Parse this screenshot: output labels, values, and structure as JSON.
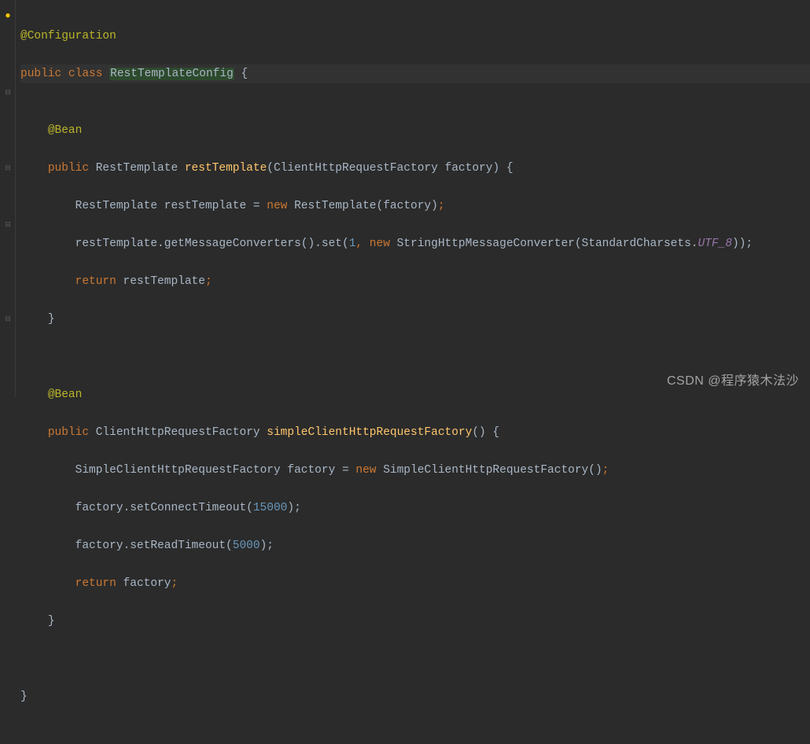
{
  "code": {
    "anno_config": "@Configuration",
    "kw_public": "public",
    "kw_class": "class",
    "class_name_hl": "RestTemplateConfig",
    "brace_open": " {",
    "anno_bean": "@Bean",
    "type_rest": "RestTemplate",
    "method_rest": "restTemplate",
    "param_paren_open": "(",
    "type_chrf": "ClientHttpRequestFactory",
    "param_factory": " factory",
    "param_paren_close_brace": ") {",
    "var_restTemplate": " restTemplate ",
    "equals": "= ",
    "kw_new": "new",
    "ctor_rest": " RestTemplate(factory)",
    "semi": ";",
    "line_getMsg": "    restTemplate.getMessageConverters().set(",
    "num_1": "1",
    "comma_sp": ", ",
    "ctor_strconv": " StringHttpMessageConverter(StandardCharsets.",
    "utf8": "UTF_8",
    "close_paren2_semi": "));",
    "kw_return": "return",
    "ret_rest": " restTemplate",
    "close_brace": "}",
    "type_simple_chrf": "SimpleClientHttpRequestFactory",
    "method_simple": "simpleClientHttpRequestFactory",
    "empty_parens_brace": "() {",
    "var_factory_eq": " factory = ",
    "ctor_simple": " SimpleClientHttpRequestFactory()",
    "set_connect": "    factory.setConnectTimeout(",
    "num_15000": "15000",
    "close_paren_semi": ");",
    "set_read": "    factory.setReadTimeout(",
    "num_5000": "5000",
    "ret_factory": " factory",
    "indent1": "    ",
    "indent2": "        "
  },
  "watermark": "CSDN @程序猿木法沙",
  "gutter": {
    "bulb": "●",
    "fold": "⊟"
  }
}
